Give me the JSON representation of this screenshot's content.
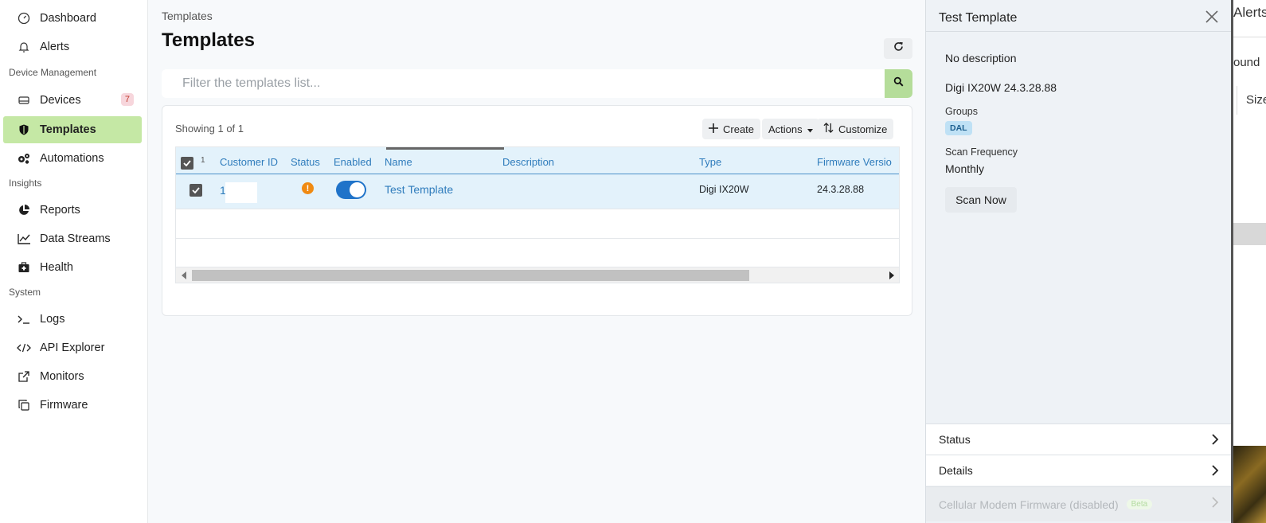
{
  "sidebar": {
    "items": [
      {
        "label": "Dashboard",
        "icon": "gauge-icon"
      },
      {
        "label": "Alerts",
        "icon": "bell-icon"
      },
      {
        "label": "Devices",
        "icon": "hard-drive-icon",
        "badge": "7"
      },
      {
        "label": "Templates",
        "icon": "shield-icon",
        "active": true
      },
      {
        "label": "Automations",
        "icon": "cogs-icon"
      },
      {
        "label": "Reports",
        "icon": "pie-chart-icon"
      },
      {
        "label": "Data Streams",
        "icon": "line-chart-icon"
      },
      {
        "label": "Health",
        "icon": "medkit-icon"
      },
      {
        "label": "Logs",
        "icon": "terminal-icon"
      },
      {
        "label": "API Explorer",
        "icon": "code-icon"
      },
      {
        "label": "Monitors",
        "icon": "external-link-icon"
      },
      {
        "label": "Firmware",
        "icon": "copy-icon"
      }
    ],
    "sections": {
      "device_management": "Device Management",
      "insights": "Insights",
      "system": "System"
    }
  },
  "main": {
    "breadcrumb": "Templates",
    "title": "Templates",
    "filter_placeholder": "Filter the templates list...",
    "showing": "Showing 1 of 1",
    "toolbar": {
      "create": "Create",
      "actions": "Actions",
      "customize": "Customize"
    },
    "table": {
      "selected_count": "1",
      "columns": [
        "Customer ID",
        "Status",
        "Enabled",
        "Name",
        "Description",
        "Type",
        "Firmware Versio"
      ],
      "rows": [
        {
          "customer_id": "1",
          "status": "warning",
          "enabled": true,
          "name": "Test Template",
          "description": "",
          "type": "Digi IX20W",
          "firmware": "24.3.28.88"
        }
      ]
    }
  },
  "panel": {
    "title": "Test Template",
    "description": "No description",
    "device_line": "Digi IX20W  24.3.28.88",
    "groups_label": "Groups",
    "group_tag": "DAL",
    "scan_frequency_label": "Scan Frequency",
    "scan_frequency_value": "Monthly",
    "scan_now": "Scan Now",
    "sections": {
      "status": "Status",
      "details": "Details",
      "cellular": "Cellular Modem Firmware (disabled)",
      "beta": "Beta"
    }
  },
  "background": {
    "alerts": "Alerts",
    "bound": "ound",
    "size": "Size"
  },
  "colors": {
    "accent_green": "#c5e8a5",
    "link_blue": "#2f7cbc",
    "toggle_blue": "#1f73c9",
    "warning": "#f08a12"
  }
}
